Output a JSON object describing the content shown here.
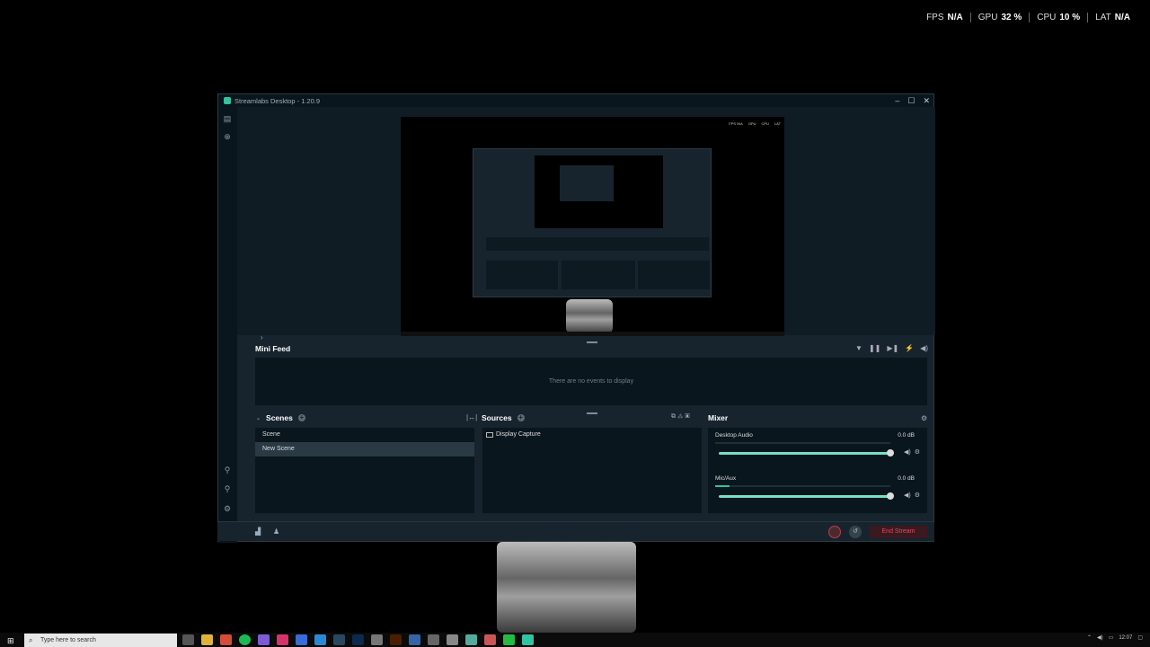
{
  "overlay": {
    "fps_label": "FPS",
    "fps_value": "N/A",
    "gpu_label": "GPU",
    "gpu_value": "32 %",
    "cpu_label": "CPU",
    "cpu_value": "10 %",
    "lat_label": "LAT",
    "lat_value": "N/A"
  },
  "window": {
    "title": "Streamlabs Desktop - 1.20.9",
    "minimize": "–",
    "maximize": "☐",
    "close": "✕"
  },
  "minifeed": {
    "title": "Mini Feed",
    "empty_text": "There are no events to display"
  },
  "scenes": {
    "title": "Scenes",
    "items": [
      "Scene",
      "New Scene"
    ]
  },
  "sources": {
    "title": "Sources",
    "items": [
      "Display Capture"
    ]
  },
  "mixer": {
    "title": "Mixer",
    "channels": [
      {
        "name": "Desktop Audio",
        "db": "0.0 dB",
        "level": 0.0,
        "volume": 1.0
      },
      {
        "name": "Mic/Aux",
        "db": "0.0 dB",
        "level": 0.08,
        "volume": 1.0
      }
    ]
  },
  "footer": {
    "end_stream_label": "End Stream"
  },
  "taskbar": {
    "search_placeholder": "Type here to search",
    "time": "12:07"
  },
  "colors": {
    "accent": "#31c3a2",
    "end_stream": "#e2495c",
    "panel_bg": "#09161d",
    "window_bg": "#17242d"
  }
}
